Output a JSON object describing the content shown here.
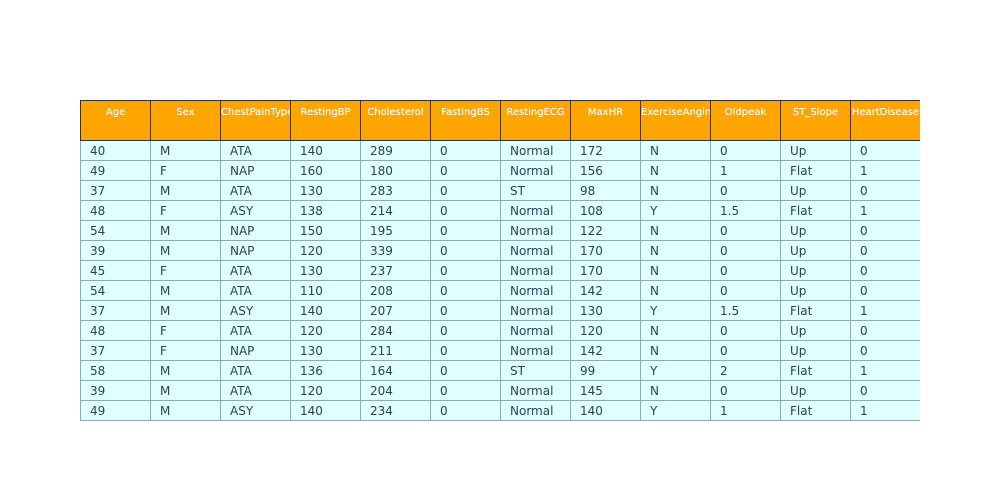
{
  "chart_data": {
    "type": "table",
    "columns": [
      "Age",
      "Sex",
      "ChestPainType",
      "RestingBP",
      "Cholesterol",
      "FastingBS",
      "RestingECG",
      "MaxHR",
      "ExerciseAngina",
      "Oldpeak",
      "ST_Slope",
      "HeartDisease"
    ],
    "rows": [
      [
        "40",
        "M",
        "ATA",
        "140",
        "289",
        "0",
        "Normal",
        "172",
        "N",
        "0",
        "Up",
        "0"
      ],
      [
        "49",
        "F",
        "NAP",
        "160",
        "180",
        "0",
        "Normal",
        "156",
        "N",
        "1",
        "Flat",
        "1"
      ],
      [
        "37",
        "M",
        "ATA",
        "130",
        "283",
        "0",
        "ST",
        "98",
        "N",
        "0",
        "Up",
        "0"
      ],
      [
        "48",
        "F",
        "ASY",
        "138",
        "214",
        "0",
        "Normal",
        "108",
        "Y",
        "1.5",
        "Flat",
        "1"
      ],
      [
        "54",
        "M",
        "NAP",
        "150",
        "195",
        "0",
        "Normal",
        "122",
        "N",
        "0",
        "Up",
        "0"
      ],
      [
        "39",
        "M",
        "NAP",
        "120",
        "339",
        "0",
        "Normal",
        "170",
        "N",
        "0",
        "Up",
        "0"
      ],
      [
        "45",
        "F",
        "ATA",
        "130",
        "237",
        "0",
        "Normal",
        "170",
        "N",
        "0",
        "Up",
        "0"
      ],
      [
        "54",
        "M",
        "ATA",
        "110",
        "208",
        "0",
        "Normal",
        "142",
        "N",
        "0",
        "Up",
        "0"
      ],
      [
        "37",
        "M",
        "ASY",
        "140",
        "207",
        "0",
        "Normal",
        "130",
        "Y",
        "1.5",
        "Flat",
        "1"
      ],
      [
        "48",
        "F",
        "ATA",
        "120",
        "284",
        "0",
        "Normal",
        "120",
        "N",
        "0",
        "Up",
        "0"
      ],
      [
        "37",
        "F",
        "NAP",
        "130",
        "211",
        "0",
        "Normal",
        "142",
        "N",
        "0",
        "Up",
        "0"
      ],
      [
        "58",
        "M",
        "ATA",
        "136",
        "164",
        "0",
        "ST",
        "99",
        "Y",
        "2",
        "Flat",
        "1"
      ],
      [
        "39",
        "M",
        "ATA",
        "120",
        "204",
        "0",
        "Normal",
        "145",
        "N",
        "0",
        "Up",
        "0"
      ],
      [
        "49",
        "M",
        "ASY",
        "140",
        "234",
        "0",
        "Normal",
        "140",
        "Y",
        "1",
        "Flat",
        "1"
      ]
    ]
  },
  "colors": {
    "header_fill": "#ffa500",
    "header_text": "#ffffff",
    "cell_fill": "#e0ffff",
    "cell_text": "#2a3f5f",
    "cell_border": "#8fa8b4",
    "header_border": "#333333"
  }
}
